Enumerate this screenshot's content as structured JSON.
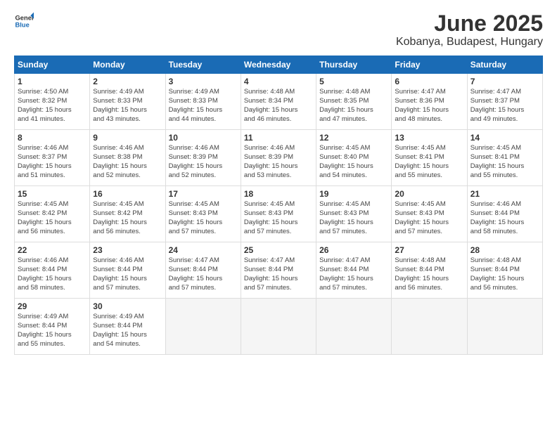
{
  "logo": {
    "general": "General",
    "blue": "Blue"
  },
  "title": "June 2025",
  "subtitle": "Kobanya, Budapest, Hungary",
  "days_header": [
    "Sunday",
    "Monday",
    "Tuesday",
    "Wednesday",
    "Thursday",
    "Friday",
    "Saturday"
  ],
  "weeks": [
    [
      {
        "day": "1",
        "info": "Sunrise: 4:50 AM\nSunset: 8:32 PM\nDaylight: 15 hours\nand 41 minutes."
      },
      {
        "day": "2",
        "info": "Sunrise: 4:49 AM\nSunset: 8:33 PM\nDaylight: 15 hours\nand 43 minutes."
      },
      {
        "day": "3",
        "info": "Sunrise: 4:49 AM\nSunset: 8:33 PM\nDaylight: 15 hours\nand 44 minutes."
      },
      {
        "day": "4",
        "info": "Sunrise: 4:48 AM\nSunset: 8:34 PM\nDaylight: 15 hours\nand 46 minutes."
      },
      {
        "day": "5",
        "info": "Sunrise: 4:48 AM\nSunset: 8:35 PM\nDaylight: 15 hours\nand 47 minutes."
      },
      {
        "day": "6",
        "info": "Sunrise: 4:47 AM\nSunset: 8:36 PM\nDaylight: 15 hours\nand 48 minutes."
      },
      {
        "day": "7",
        "info": "Sunrise: 4:47 AM\nSunset: 8:37 PM\nDaylight: 15 hours\nand 49 minutes."
      }
    ],
    [
      {
        "day": "8",
        "info": "Sunrise: 4:46 AM\nSunset: 8:37 PM\nDaylight: 15 hours\nand 51 minutes."
      },
      {
        "day": "9",
        "info": "Sunrise: 4:46 AM\nSunset: 8:38 PM\nDaylight: 15 hours\nand 52 minutes."
      },
      {
        "day": "10",
        "info": "Sunrise: 4:46 AM\nSunset: 8:39 PM\nDaylight: 15 hours\nand 52 minutes."
      },
      {
        "day": "11",
        "info": "Sunrise: 4:46 AM\nSunset: 8:39 PM\nDaylight: 15 hours\nand 53 minutes."
      },
      {
        "day": "12",
        "info": "Sunrise: 4:45 AM\nSunset: 8:40 PM\nDaylight: 15 hours\nand 54 minutes."
      },
      {
        "day": "13",
        "info": "Sunrise: 4:45 AM\nSunset: 8:41 PM\nDaylight: 15 hours\nand 55 minutes."
      },
      {
        "day": "14",
        "info": "Sunrise: 4:45 AM\nSunset: 8:41 PM\nDaylight: 15 hours\nand 55 minutes."
      }
    ],
    [
      {
        "day": "15",
        "info": "Sunrise: 4:45 AM\nSunset: 8:42 PM\nDaylight: 15 hours\nand 56 minutes."
      },
      {
        "day": "16",
        "info": "Sunrise: 4:45 AM\nSunset: 8:42 PM\nDaylight: 15 hours\nand 56 minutes."
      },
      {
        "day": "17",
        "info": "Sunrise: 4:45 AM\nSunset: 8:43 PM\nDaylight: 15 hours\nand 57 minutes."
      },
      {
        "day": "18",
        "info": "Sunrise: 4:45 AM\nSunset: 8:43 PM\nDaylight: 15 hours\nand 57 minutes."
      },
      {
        "day": "19",
        "info": "Sunrise: 4:45 AM\nSunset: 8:43 PM\nDaylight: 15 hours\nand 57 minutes."
      },
      {
        "day": "20",
        "info": "Sunrise: 4:45 AM\nSunset: 8:43 PM\nDaylight: 15 hours\nand 57 minutes."
      },
      {
        "day": "21",
        "info": "Sunrise: 4:46 AM\nSunset: 8:44 PM\nDaylight: 15 hours\nand 58 minutes."
      }
    ],
    [
      {
        "day": "22",
        "info": "Sunrise: 4:46 AM\nSunset: 8:44 PM\nDaylight: 15 hours\nand 58 minutes."
      },
      {
        "day": "23",
        "info": "Sunrise: 4:46 AM\nSunset: 8:44 PM\nDaylight: 15 hours\nand 57 minutes."
      },
      {
        "day": "24",
        "info": "Sunrise: 4:47 AM\nSunset: 8:44 PM\nDaylight: 15 hours\nand 57 minutes."
      },
      {
        "day": "25",
        "info": "Sunrise: 4:47 AM\nSunset: 8:44 PM\nDaylight: 15 hours\nand 57 minutes."
      },
      {
        "day": "26",
        "info": "Sunrise: 4:47 AM\nSunset: 8:44 PM\nDaylight: 15 hours\nand 57 minutes."
      },
      {
        "day": "27",
        "info": "Sunrise: 4:48 AM\nSunset: 8:44 PM\nDaylight: 15 hours\nand 56 minutes."
      },
      {
        "day": "28",
        "info": "Sunrise: 4:48 AM\nSunset: 8:44 PM\nDaylight: 15 hours\nand 56 minutes."
      }
    ],
    [
      {
        "day": "29",
        "info": "Sunrise: 4:49 AM\nSunset: 8:44 PM\nDaylight: 15 hours\nand 55 minutes."
      },
      {
        "day": "30",
        "info": "Sunrise: 4:49 AM\nSunset: 8:44 PM\nDaylight: 15 hours\nand 54 minutes."
      },
      {
        "day": "",
        "info": ""
      },
      {
        "day": "",
        "info": ""
      },
      {
        "day": "",
        "info": ""
      },
      {
        "day": "",
        "info": ""
      },
      {
        "day": "",
        "info": ""
      }
    ]
  ]
}
